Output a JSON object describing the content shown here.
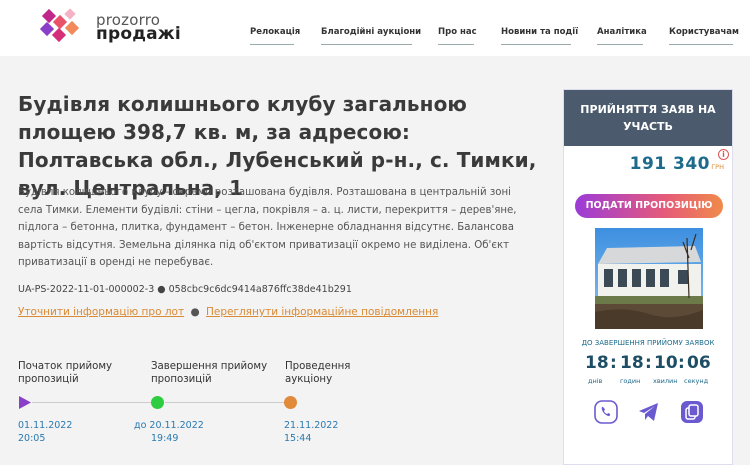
{
  "brand": {
    "line1": "prozorro",
    "line2": "продажі"
  },
  "nav": [
    "Релокація",
    "Благодійні аукціони",
    "Про нас",
    "Новини та події",
    "Аналітика",
    "Користувачам"
  ],
  "lot": {
    "title": "Будівля колишнього клубу загальною площею 398,7 кв. м, за адресою: Полтавська обл., Лубенський р-н., с. Тимки, вул. Центральна, 1",
    "description": "Будівля колишнього клубу - окремо розташована будівля. Розташована в центральній зоні села Тимки. Елементи будівлі: стіни – цегла, покрівля – а. ц. листи, перекриття – дерев'яне, підлога – бетонна, плитка, фундамент – бетон. Інженерне обладнання відсутнє. Балансова вартість відсутня. Земельна ділянка під об'єктом приватизації окремо не виділена. Об'єкт приватизації в оренді не перебуває.",
    "id": "UA-PS-2022-11-01-000002-3",
    "hash": "058cbc9c6dc9414a876ffc38de41b291",
    "link1": "Уточнити інформацію про лот",
    "link2": "Переглянути інформаційне повідомлення"
  },
  "timeline": [
    {
      "label": "Початок прийому пропозицій",
      "date": "01.11.2022",
      "time": "20:05",
      "color": "#8a3fc8"
    },
    {
      "label": "Завершення прийому пропозицій",
      "date": "до 20.11.2022",
      "time": "19:49",
      "color": "#2ecc40"
    },
    {
      "label": "Проведення аукціону",
      "date": "21.11.2022",
      "time": "15:44",
      "color": "#e08a3a"
    }
  ],
  "card": {
    "status": "ПРИЙНЯТТЯ ЗАЯВ НА УЧАСТЬ",
    "price": "191 340",
    "currency": "ГРН",
    "info": "i",
    "button": "ПОДАТИ ПРОПОЗИЦІЮ",
    "countdown_label": "ДО ЗАВЕРШЕННЯ ПРИЙОМУ ЗАЯВОК",
    "countdown": [
      {
        "value": "18",
        "unit": "днів"
      },
      {
        "value": "18",
        "unit": "годин"
      },
      {
        "value": "10",
        "unit": "хвилин"
      },
      {
        "value": "06",
        "unit": "секунд"
      }
    ],
    "social": [
      "viber-icon",
      "telegram-icon",
      "copy-link-icon"
    ]
  },
  "colors": {
    "accent": "#d98a35",
    "header_dark": "#4b5b6d",
    "price": "#1d6a8c"
  }
}
